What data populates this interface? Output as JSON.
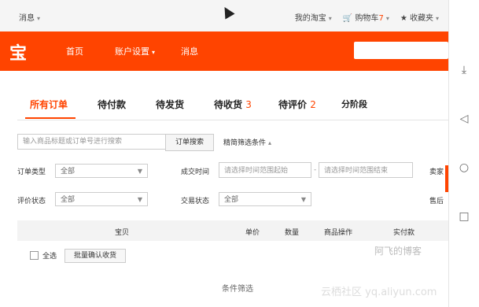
{
  "topbar": {
    "messages": "消息",
    "my_taobao": "我的淘宝",
    "cart": "购物车",
    "cart_count": "7",
    "favorites": "收藏夹"
  },
  "nav": {
    "logo": "宝",
    "home": "首页",
    "account": "账户设置",
    "messages": "消息"
  },
  "tabs": [
    {
      "label": "所有订单",
      "count": ""
    },
    {
      "label": "待付款",
      "count": ""
    },
    {
      "label": "待发货",
      "count": ""
    },
    {
      "label": "待收货",
      "count": "3"
    },
    {
      "label": "待评价",
      "count": "2"
    },
    {
      "label": "分阶段",
      "count": ""
    }
  ],
  "search": {
    "placeholder": "输入商品标题或订单号进行搜索",
    "button": "订单搜索",
    "advanced": "精简筛选条件"
  },
  "filters": {
    "order_type_label": "订单类型",
    "order_type_value": "全部",
    "time_label": "成交时间",
    "time_start_placeholder": "请选择时间范围起始",
    "time_end_placeholder": "请选择时间范围结束",
    "seller_label": "卖家",
    "review_label": "评价状态",
    "review_value": "全部",
    "trade_label": "交易状态",
    "trade_value": "全部",
    "aftersale_label": "售后"
  },
  "table": {
    "columns": [
      "宝贝",
      "单价",
      "数量",
      "商品操作",
      "实付款"
    ]
  },
  "bulk": {
    "select_all": "全选",
    "confirm_button": "批量确认收货"
  },
  "caption": "条件筛选",
  "watermarks": {
    "blog": "阿飞的博客",
    "site": "云栖社区 yq.aliyun.com"
  },
  "colors": {
    "accent": "#ff4400"
  }
}
